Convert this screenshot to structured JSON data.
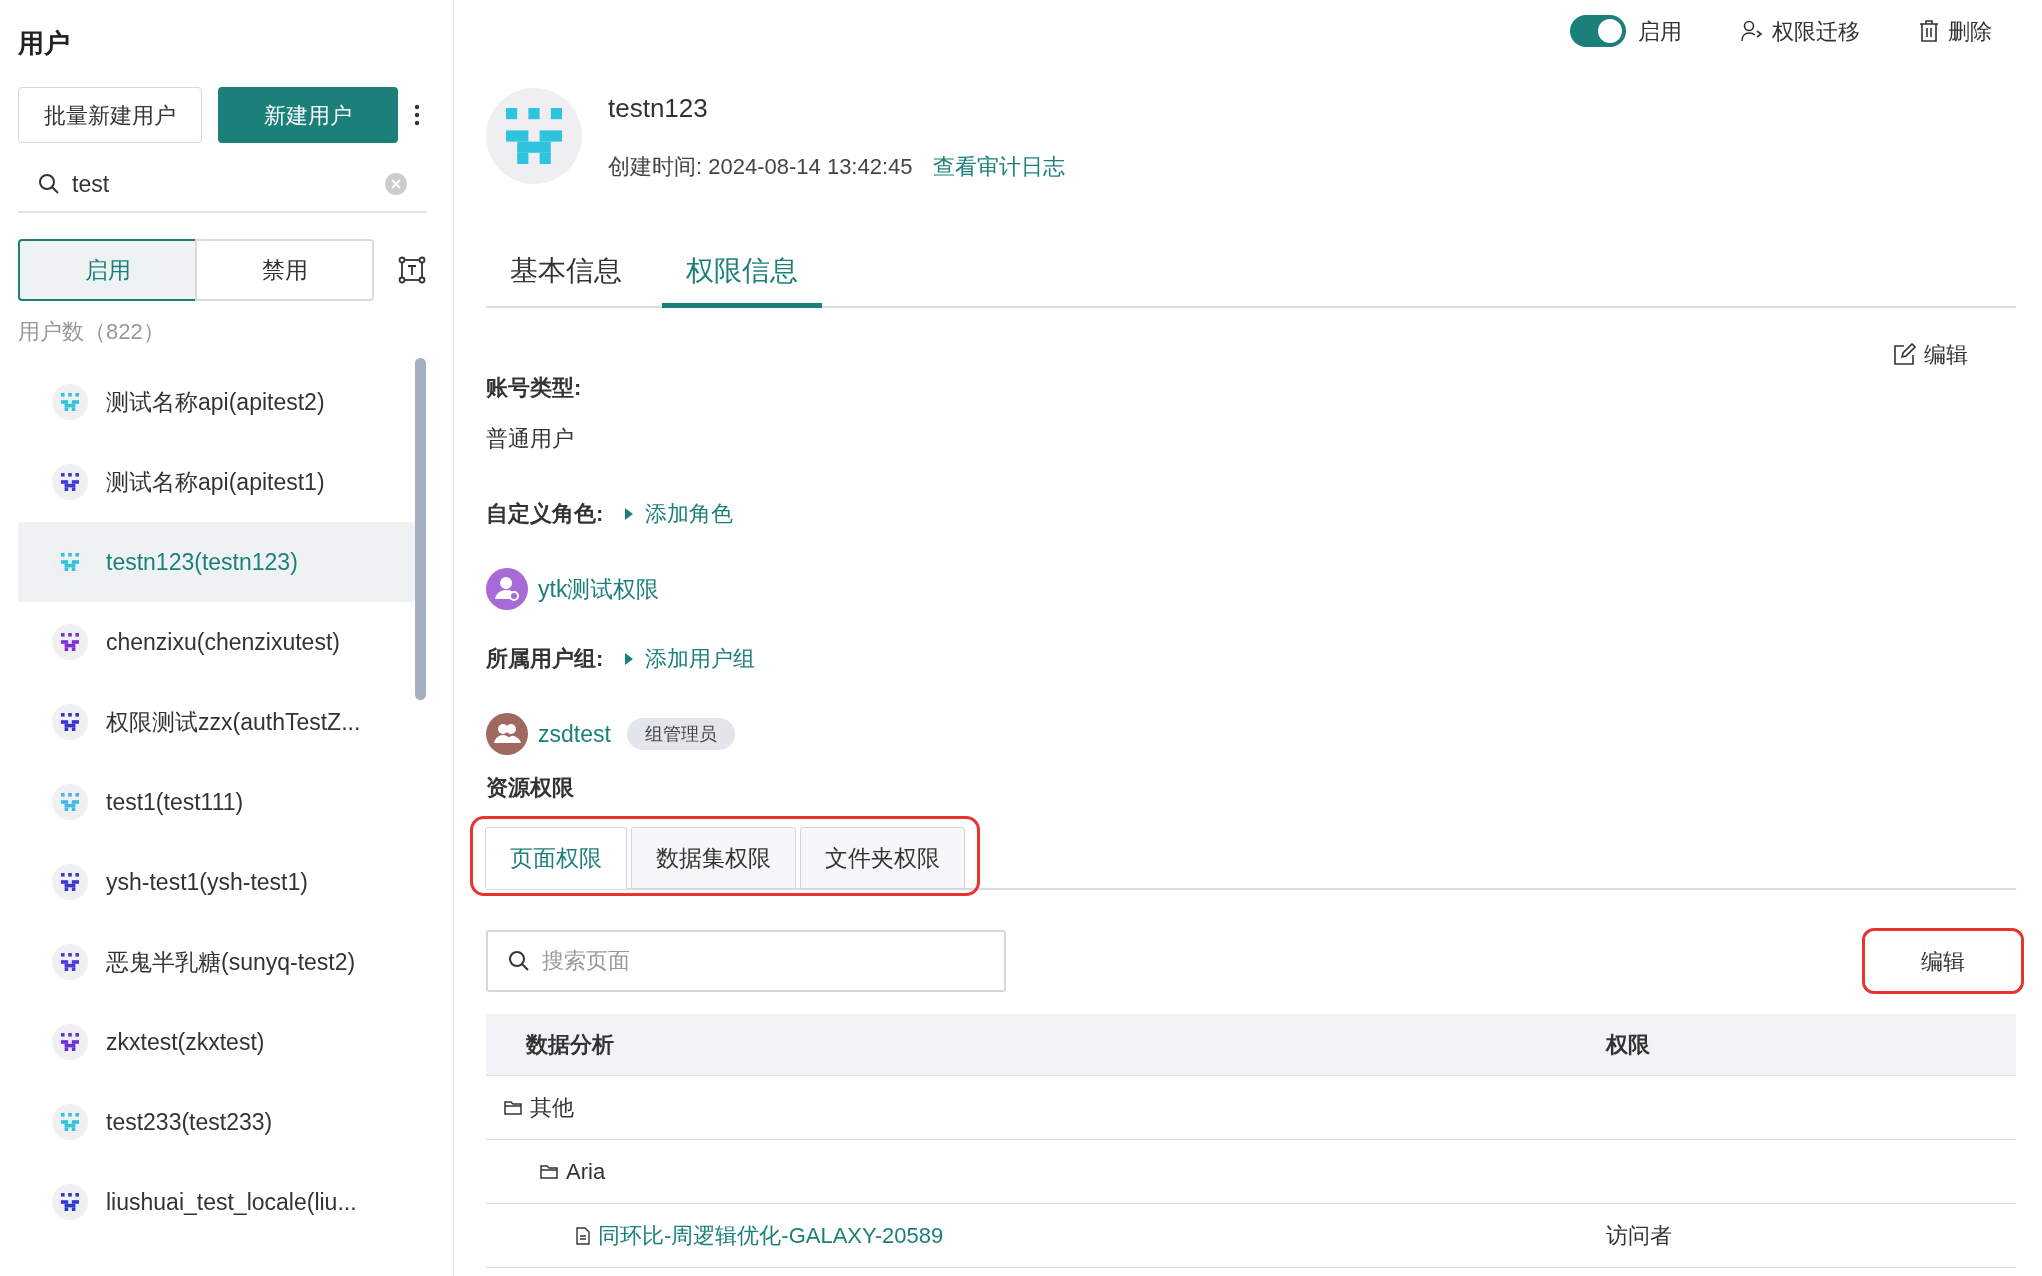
{
  "sidebar": {
    "title": "用户",
    "batch_button": "批量新建用户",
    "create_button": "新建用户",
    "search": {
      "value": "test"
    },
    "segments": [
      {
        "label": "启用",
        "selected": true
      },
      {
        "label": "禁用",
        "selected": false
      }
    ],
    "count": "用户数（822）",
    "users": [
      {
        "label": "测试名称api(apitest2)",
        "color": "#2ec4e0",
        "selected": false
      },
      {
        "label": "测试名称api(apitest1)",
        "color": "#3b3bd6",
        "selected": false
      },
      {
        "label": "testn123(testn123)",
        "color": "#2ec4e0",
        "selected": true
      },
      {
        "label": "chenzixu(chenzixutest)",
        "color": "#7b2fd6",
        "selected": false
      },
      {
        "label": "权限测试zzx(authTestZ...",
        "color": "#3434d0",
        "selected": false
      },
      {
        "label": "test1(test111)",
        "color": "#3fb8e8",
        "selected": false
      },
      {
        "label": "ysh-test1(ysh-test1)",
        "color": "#3a3ad0",
        "selected": false
      },
      {
        "label": "恶鬼半乳糖(sunyq-test2)",
        "color": "#4a3ad8",
        "selected": false
      },
      {
        "label": "zkxtest(zkxtest)",
        "color": "#6a2ed8",
        "selected": false
      },
      {
        "label": "test233(test233)",
        "color": "#2ec4e0",
        "selected": false
      },
      {
        "label": "liushuai_test_locale(liu...",
        "color": "#2a3ad0",
        "selected": false
      }
    ]
  },
  "toolbar": {
    "toggle": {
      "label": "启用",
      "on": true
    },
    "transfer": "权限迁移",
    "delete": "删除"
  },
  "profile": {
    "name": "testn123",
    "created_label": "创建时间:",
    "created_value": "2024-08-14 13:42:45",
    "audit_link": "查看审计日志"
  },
  "tabs": [
    {
      "label": "基本信息",
      "selected": false
    },
    {
      "label": "权限信息",
      "selected": true
    }
  ],
  "edit_link": "编辑",
  "account_type": {
    "label": "账号类型:",
    "value": "普通用户"
  },
  "roles": {
    "label": "自定义角色:",
    "add": "添加角色",
    "items": [
      {
        "name": "ytk测试权限"
      }
    ]
  },
  "groups": {
    "label": "所属用户组:",
    "add": "添加用户组",
    "items": [
      {
        "name": "zsdtest",
        "badge": "组管理员"
      }
    ]
  },
  "resources": {
    "title": "资源权限",
    "tabs": [
      {
        "label": "页面权限",
        "selected": true
      },
      {
        "label": "数据集权限",
        "selected": false
      },
      {
        "label": "文件夹权限",
        "selected": false
      }
    ],
    "search": {
      "placeholder": "搜索页面"
    },
    "edit_button": "编辑",
    "table": {
      "columns": [
        "数据分析",
        "权限"
      ],
      "rows": [
        {
          "kind": "folder",
          "name": "其他",
          "children": [
            {
              "kind": "folder",
              "name": "Aria",
              "children": [
                {
                  "kind": "file",
                  "name": "同环比-周逻辑优化-GALAXY-20589",
                  "permission": "访问者"
                }
              ]
            }
          ]
        }
      ]
    }
  }
}
